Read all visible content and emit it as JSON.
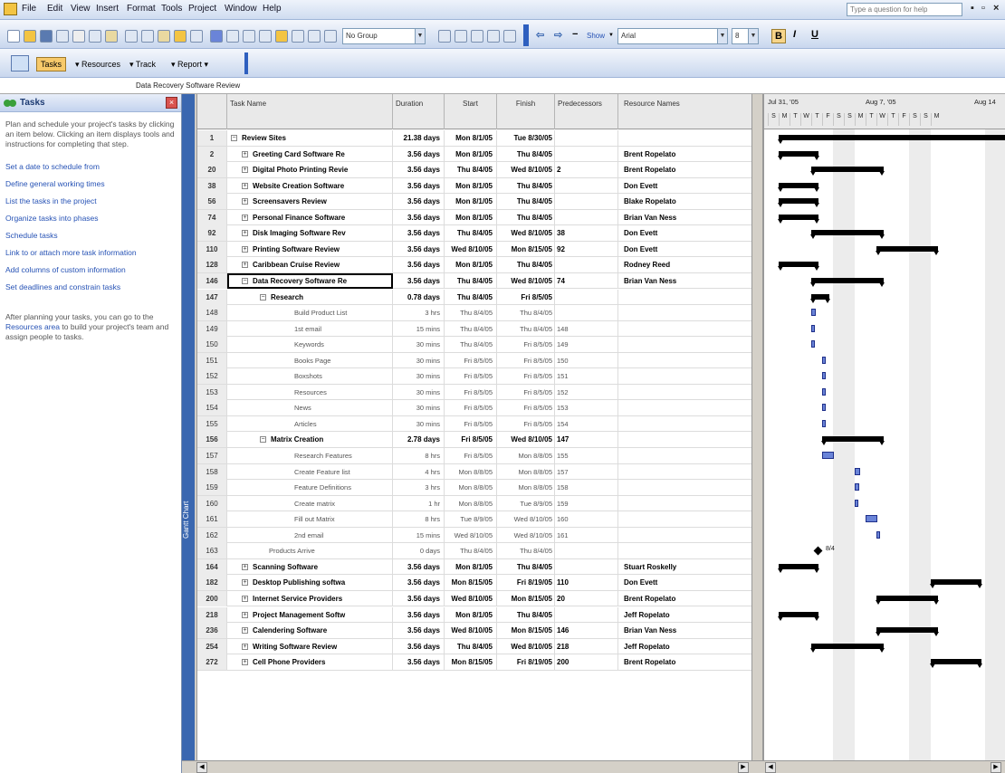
{
  "menubar": {
    "items": [
      "File",
      "Edit",
      "View",
      "Insert",
      "Format",
      "Tools",
      "Project",
      "Window",
      "Help"
    ],
    "help_placeholder": "Type a question for help"
  },
  "toolbar": {
    "group_value": "No Group",
    "show_label": "Show",
    "font_value": "Arial",
    "size_value": "8",
    "bold_label": "B",
    "italic_label": "I",
    "underline_label": "U"
  },
  "guide": {
    "tasks_label": "Tasks",
    "resources_label": "Resources",
    "track_label": "Track",
    "report_label": "Report"
  },
  "entry_bar_text": "Data Recovery Software Review",
  "task_pane": {
    "title": "Tasks",
    "intro": "Plan and schedule your project's tasks by clicking an item below. Clicking an item displays tools and instructions for completing that step.",
    "links": [
      "Set a date to schedule from",
      "Define general working times",
      "List the tasks in the project",
      "Organize tasks into phases",
      "Schedule tasks",
      "Link to or attach more task information",
      "Add columns of custom information",
      "Set deadlines and constrain tasks"
    ],
    "bottom_pre": "After planning your tasks, you can go to the ",
    "bottom_link": "Resources area",
    "bottom_post": " to build your project's team and assign people to tasks."
  },
  "view_bar_label": "Gantt Chart",
  "columns": [
    "Task Name",
    "Duration",
    "Start",
    "Finish",
    "Predecessors",
    "Resource Names"
  ],
  "tasks": [
    {
      "id": "1",
      "name": "Review Sites",
      "duration": "21.38 days",
      "start": "Mon 8/1/05",
      "finish": "Tue 8/30/05",
      "pred": "",
      "res": "",
      "level": 0,
      "summary": true,
      "exp": "−"
    },
    {
      "id": "2",
      "name": "Greeting Card Software Re",
      "duration": "3.56 days",
      "start": "Mon 8/1/05",
      "finish": "Thu 8/4/05",
      "pred": "",
      "res": "Brent Ropelato",
      "level": 1,
      "summary": true,
      "exp": "+"
    },
    {
      "id": "20",
      "name": "Digital Photo Printing Revie",
      "duration": "3.56 days",
      "start": "Thu 8/4/05",
      "finish": "Wed 8/10/05",
      "pred": "2",
      "res": "Brent Ropelato",
      "level": 1,
      "summary": true,
      "exp": "+"
    },
    {
      "id": "38",
      "name": "Website Creation Software",
      "duration": "3.56 days",
      "start": "Mon 8/1/05",
      "finish": "Thu 8/4/05",
      "pred": "",
      "res": "Don Evett",
      "level": 1,
      "summary": true,
      "exp": "+"
    },
    {
      "id": "56",
      "name": "Screensavers Review",
      "duration": "3.56 days",
      "start": "Mon 8/1/05",
      "finish": "Thu 8/4/05",
      "pred": "",
      "res": "Blake Ropelato",
      "level": 1,
      "summary": true,
      "exp": "+"
    },
    {
      "id": "74",
      "name": "Personal Finance Software",
      "duration": "3.56 days",
      "start": "Mon 8/1/05",
      "finish": "Thu 8/4/05",
      "pred": "",
      "res": "Brian Van Ness",
      "level": 1,
      "summary": true,
      "exp": "+"
    },
    {
      "id": "92",
      "name": "Disk Imaging Software Rev",
      "duration": "3.56 days",
      "start": "Thu 8/4/05",
      "finish": "Wed 8/10/05",
      "pred": "38",
      "res": "Don Evett",
      "level": 1,
      "summary": true,
      "exp": "+"
    },
    {
      "id": "110",
      "name": "Printing Software Review",
      "duration": "3.56 days",
      "start": "Wed 8/10/05",
      "finish": "Mon 8/15/05",
      "pred": "92",
      "res": "Don Evett",
      "level": 1,
      "summary": true,
      "exp": "+"
    },
    {
      "id": "128",
      "name": "Caribbean Cruise Review",
      "duration": "3.56 days",
      "start": "Mon 8/1/05",
      "finish": "Thu 8/4/05",
      "pred": "",
      "res": "Rodney Reed",
      "level": 1,
      "summary": true,
      "exp": "+"
    },
    {
      "id": "146",
      "name": "Data Recovery Software Re",
      "duration": "3.56 days",
      "start": "Thu 8/4/05",
      "finish": "Wed 8/10/05",
      "pred": "74",
      "res": "Brian Van Ness",
      "level": 1,
      "summary": true,
      "exp": "−",
      "selected": true
    },
    {
      "id": "147",
      "name": "Research",
      "duration": "0.78 days",
      "start": "Thu 8/4/05",
      "finish": "Fri 8/5/05",
      "pred": "",
      "res": "",
      "level": 2,
      "summary": true,
      "exp": "−"
    },
    {
      "id": "148",
      "name": "Build Product List",
      "duration": "3 hrs",
      "start": "Thu 8/4/05",
      "finish": "Thu 8/4/05",
      "pred": "",
      "res": "",
      "level": 3,
      "summary": false
    },
    {
      "id": "149",
      "name": "1st email",
      "duration": "15 mins",
      "start": "Thu 8/4/05",
      "finish": "Thu 8/4/05",
      "pred": "148",
      "res": "",
      "level": 3,
      "summary": false
    },
    {
      "id": "150",
      "name": "Keywords",
      "duration": "30 mins",
      "start": "Thu 8/4/05",
      "finish": "Fri 8/5/05",
      "pred": "149",
      "res": "",
      "level": 3,
      "summary": false
    },
    {
      "id": "151",
      "name": "Books Page",
      "duration": "30 mins",
      "start": "Fri 8/5/05",
      "finish": "Fri 8/5/05",
      "pred": "150",
      "res": "",
      "level": 3,
      "summary": false
    },
    {
      "id": "152",
      "name": "Boxshots",
      "duration": "30 mins",
      "start": "Fri 8/5/05",
      "finish": "Fri 8/5/05",
      "pred": "151",
      "res": "",
      "level": 3,
      "summary": false
    },
    {
      "id": "153",
      "name": "Resources",
      "duration": "30 mins",
      "start": "Fri 8/5/05",
      "finish": "Fri 8/5/05",
      "pred": "152",
      "res": "",
      "level": 3,
      "summary": false
    },
    {
      "id": "154",
      "name": "News",
      "duration": "30 mins",
      "start": "Fri 8/5/05",
      "finish": "Fri 8/5/05",
      "pred": "153",
      "res": "",
      "level": 3,
      "summary": false
    },
    {
      "id": "155",
      "name": "Articles",
      "duration": "30 mins",
      "start": "Fri 8/5/05",
      "finish": "Fri 8/5/05",
      "pred": "154",
      "res": "",
      "level": 3,
      "summary": false
    },
    {
      "id": "156",
      "name": "Matrix Creation",
      "duration": "2.78 days",
      "start": "Fri 8/5/05",
      "finish": "Wed 8/10/05",
      "pred": "147",
      "res": "",
      "level": 2,
      "summary": true,
      "exp": "−"
    },
    {
      "id": "157",
      "name": "Research Features",
      "duration": "8 hrs",
      "start": "Fri 8/5/05",
      "finish": "Mon 8/8/05",
      "pred": "155",
      "res": "",
      "level": 3,
      "summary": false
    },
    {
      "id": "158",
      "name": "Create Feature list",
      "duration": "4 hrs",
      "start": "Mon 8/8/05",
      "finish": "Mon 8/8/05",
      "pred": "157",
      "res": "",
      "level": 3,
      "summary": false
    },
    {
      "id": "159",
      "name": "Feature Definitions",
      "duration": "3 hrs",
      "start": "Mon 8/8/05",
      "finish": "Mon 8/8/05",
      "pred": "158",
      "res": "",
      "level": 3,
      "summary": false
    },
    {
      "id": "160",
      "name": "Create matrix",
      "duration": "1 hr",
      "start": "Mon 8/8/05",
      "finish": "Tue 8/9/05",
      "pred": "159",
      "res": "",
      "level": 3,
      "summary": false
    },
    {
      "id": "161",
      "name": "Fill out Matrix",
      "duration": "8 hrs",
      "start": "Tue 8/9/05",
      "finish": "Wed 8/10/05",
      "pred": "160",
      "res": "",
      "level": 3,
      "summary": false
    },
    {
      "id": "162",
      "name": "2nd email",
      "duration": "15 mins",
      "start": "Wed 8/10/05",
      "finish": "Wed 8/10/05",
      "pred": "161",
      "res": "",
      "level": 3,
      "summary": false
    },
    {
      "id": "163",
      "name": "Products Arrive",
      "duration": "0 days",
      "start": "Thu 8/4/05",
      "finish": "Thu 8/4/05",
      "pred": "",
      "res": "",
      "level": 2,
      "summary": false
    },
    {
      "id": "164",
      "name": "Scanning Software",
      "duration": "3.56 days",
      "start": "Mon 8/1/05",
      "finish": "Thu 8/4/05",
      "pred": "",
      "res": "Stuart Roskelly",
      "level": 1,
      "summary": true,
      "exp": "+"
    },
    {
      "id": "182",
      "name": "Desktop Publishing softwa",
      "duration": "3.56 days",
      "start": "Mon 8/15/05",
      "finish": "Fri 8/19/05",
      "pred": "110",
      "res": "Don Evett",
      "level": 1,
      "summary": true,
      "exp": "+"
    },
    {
      "id": "200",
      "name": "Internet Service Providers",
      "duration": "3.56 days",
      "start": "Wed 8/10/05",
      "finish": "Mon 8/15/05",
      "pred": "20",
      "res": "Brent Ropelato",
      "level": 1,
      "summary": true,
      "exp": "+"
    },
    {
      "id": "218",
      "name": "Project Management Softw",
      "duration": "3.56 days",
      "start": "Mon 8/1/05",
      "finish": "Thu 8/4/05",
      "pred": "",
      "res": "Jeff Ropelato",
      "level": 1,
      "summary": true,
      "exp": "+"
    },
    {
      "id": "236",
      "name": "Calendering Software",
      "duration": "3.56 days",
      "start": "Wed 8/10/05",
      "finish": "Mon 8/15/05",
      "pred": "146",
      "res": "Brian Van Ness",
      "level": 1,
      "summary": true,
      "exp": "+"
    },
    {
      "id": "254",
      "name": "Writing Software Review",
      "duration": "3.56 days",
      "start": "Thu 8/4/05",
      "finish": "Wed 8/10/05",
      "pred": "218",
      "res": "Jeff Ropelato",
      "level": 1,
      "summary": true,
      "exp": "+"
    },
    {
      "id": "272",
      "name": "Cell Phone Providers",
      "duration": "3.56 days",
      "start": "Mon 8/15/05",
      "finish": "Fri 8/19/05",
      "pred": "200",
      "res": "Brent Ropelato",
      "level": 1,
      "summary": true,
      "exp": "+"
    }
  ],
  "gantt": {
    "weeks": [
      "Jul 31, '05",
      "Aug 7, '05",
      "Aug 14"
    ],
    "days": [
      "S",
      "M",
      "T",
      "W",
      "T",
      "F",
      "S",
      "S",
      "M",
      "T",
      "W",
      "T",
      "F",
      "S",
      "S",
      "M"
    ],
    "milestone_label": "8/4"
  },
  "colors": {
    "task_bar": "#6a84d8",
    "summary_bar": "#000000",
    "link_color": "#2652b5"
  }
}
